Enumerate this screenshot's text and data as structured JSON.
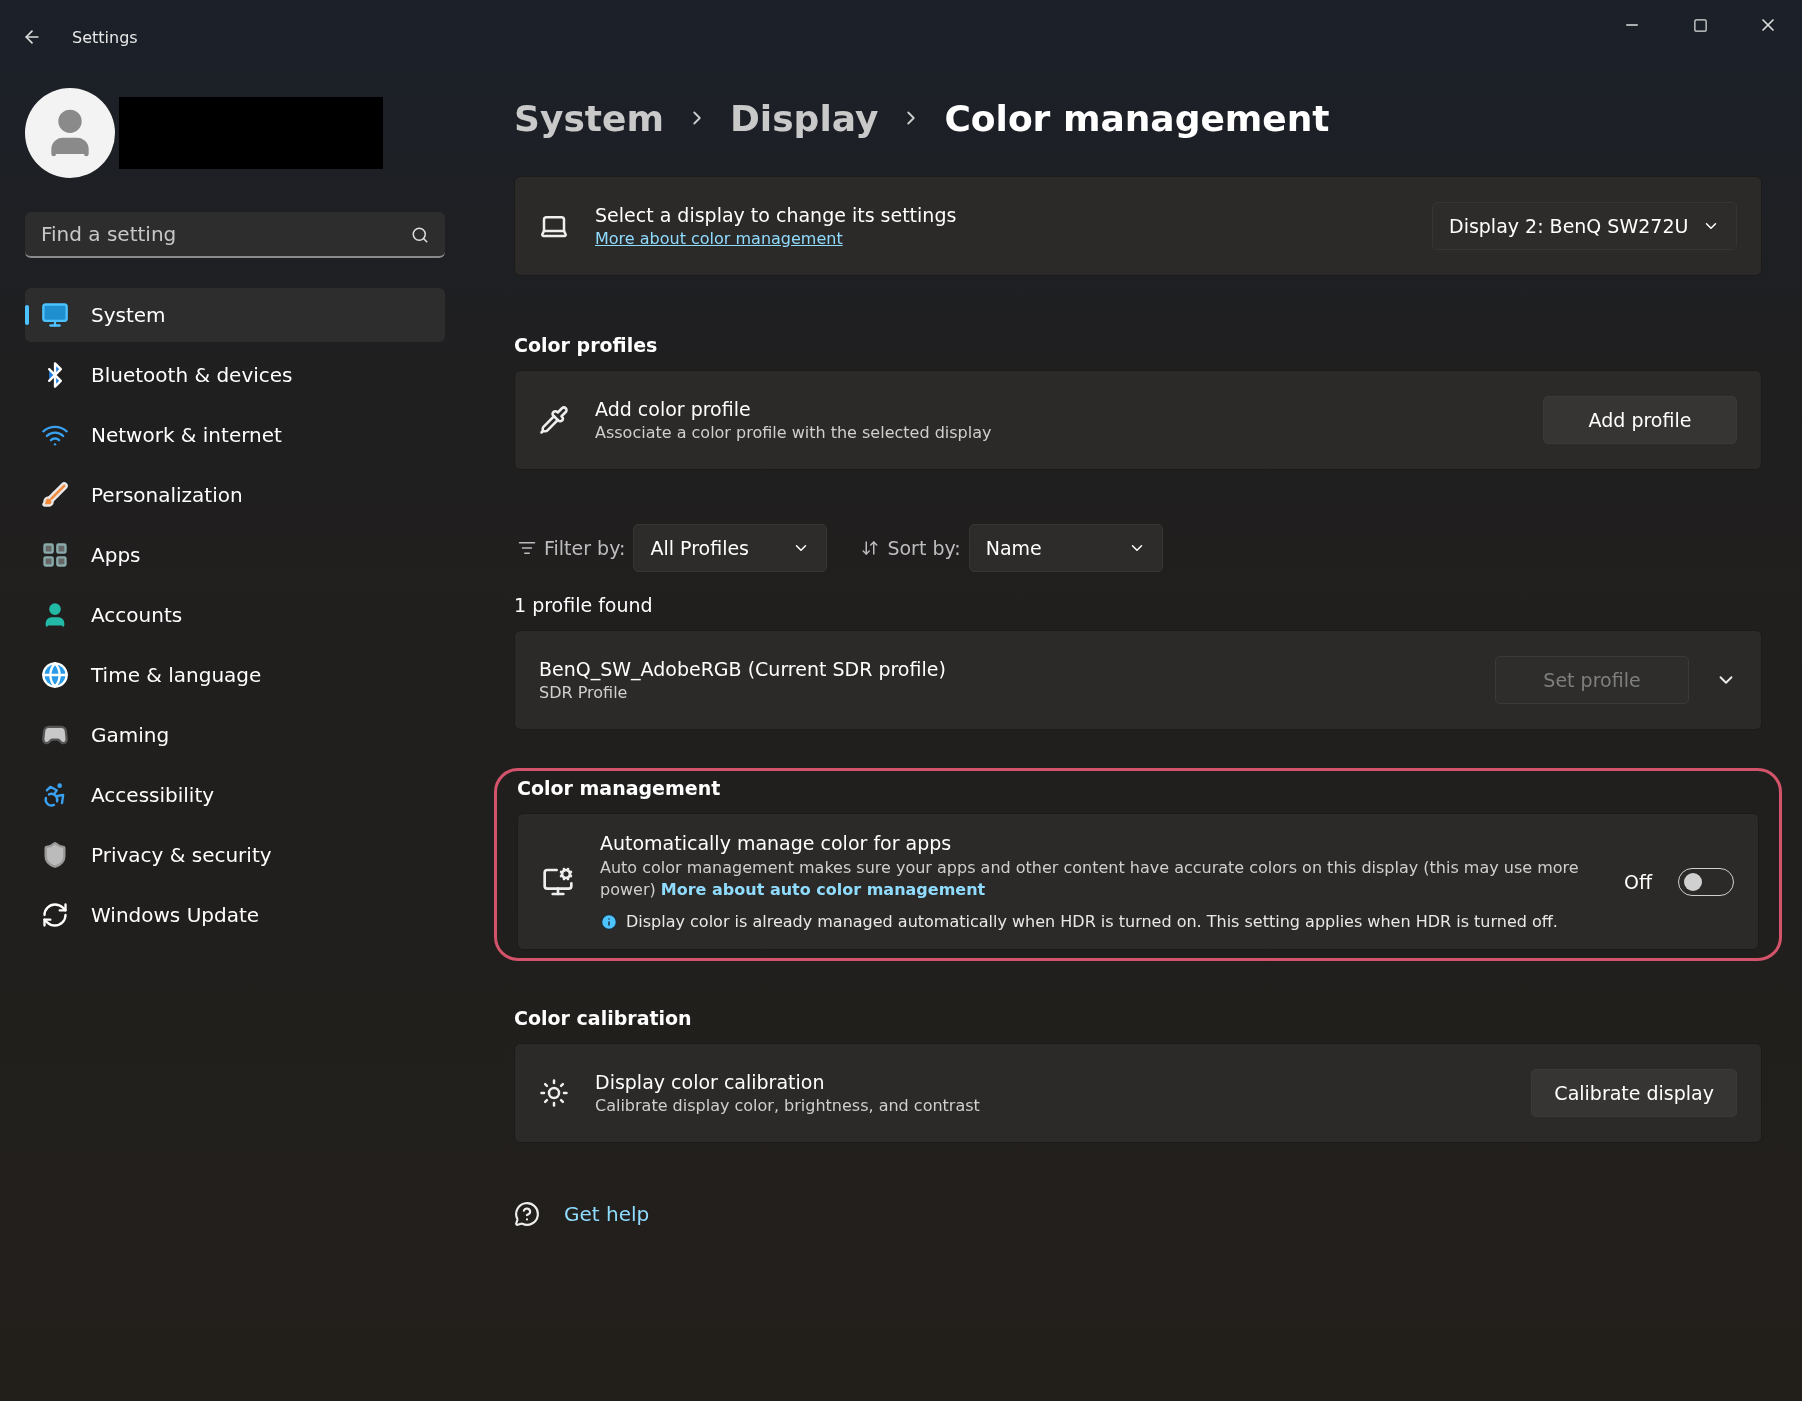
{
  "window": {
    "title": "Settings"
  },
  "search": {
    "placeholder": "Find a setting"
  },
  "nav": [
    {
      "label": "System",
      "selected": true
    },
    {
      "label": "Bluetooth & devices",
      "selected": false
    },
    {
      "label": "Network & internet",
      "selected": false
    },
    {
      "label": "Personalization",
      "selected": false
    },
    {
      "label": "Apps",
      "selected": false
    },
    {
      "label": "Accounts",
      "selected": false
    },
    {
      "label": "Time & language",
      "selected": false
    },
    {
      "label": "Gaming",
      "selected": false
    },
    {
      "label": "Accessibility",
      "selected": false
    },
    {
      "label": "Privacy & security",
      "selected": false
    },
    {
      "label": "Windows Update",
      "selected": false
    }
  ],
  "breadcrumb": [
    "System",
    "Display",
    "Color management"
  ],
  "display_card": {
    "title": "Select a display to change its settings",
    "link": "More about color management",
    "dropdown": "Display 2: BenQ SW272U"
  },
  "color_profiles": {
    "heading": "Color profiles",
    "title": "Add color profile",
    "subtitle": "Associate a color profile with the selected display",
    "button": "Add profile"
  },
  "filter": {
    "label": "Filter by:",
    "value": "All Profiles"
  },
  "sort": {
    "label": "Sort by:",
    "value": "Name"
  },
  "profiles_found": "1 profile found",
  "profiles": [
    {
      "name": "BenQ_SW_AdobeRGB (Current SDR profile)",
      "type": "SDR Profile",
      "button": "Set profile",
      "disabled": true,
      "expanded": false
    }
  ],
  "color_management": {
    "heading": "Color management",
    "highlighted": true,
    "title": "Automatically manage color for apps",
    "description": "Auto color management makes sure your apps and other content have accurate colors on this display (this may use more power)",
    "link": "More about auto color management",
    "note": "Display color is already managed automatically when HDR is turned on. This setting applies when HDR is turned off.",
    "toggle_label": "Off",
    "on": false
  },
  "calibration": {
    "heading": "Color calibration",
    "title": "Display color calibration",
    "subtitle": "Calibrate display color, brightness, and contrast",
    "button": "Calibrate display"
  },
  "help": "Get help"
}
